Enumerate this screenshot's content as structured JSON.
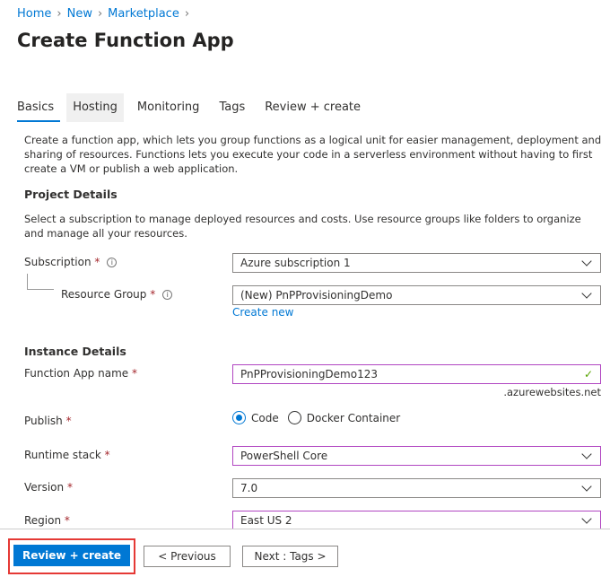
{
  "breadcrumb": [
    "Home",
    "New",
    "Marketplace"
  ],
  "title": "Create Function App",
  "tabs": [
    "Basics",
    "Hosting",
    "Monitoring",
    "Tags",
    "Review + create"
  ],
  "intro": "Create a function app, which lets you group functions as a logical unit for easier management, deployment and sharing of resources. Functions lets you execute your code in a serverless environment without having to first create a VM or publish a web application.",
  "project": {
    "heading": "Project Details",
    "description": "Select a subscription to manage deployed resources and costs. Use resource groups like folders to organize and manage all your resources.",
    "subscription_label": "Subscription",
    "subscription_value": "Azure subscription 1",
    "rg_label": "Resource Group",
    "rg_value": "(New) PnPProvisioningDemo",
    "create_new": "Create new"
  },
  "instance": {
    "heading": "Instance Details",
    "name_label": "Function App name",
    "name_value": "PnPProvisioningDemo123",
    "suffix": ".azurewebsites.net",
    "publish_label": "Publish",
    "publish_options": [
      "Code",
      "Docker Container"
    ],
    "runtime_label": "Runtime stack",
    "runtime_value": "PowerShell Core",
    "version_label": "Version",
    "version_value": "7.0",
    "region_label": "Region",
    "region_value": "East US 2"
  },
  "req": "*",
  "info": "i",
  "check": "✓",
  "footer": {
    "review": "Review + create",
    "previous": "< Previous",
    "next": "Next : Tags >"
  }
}
